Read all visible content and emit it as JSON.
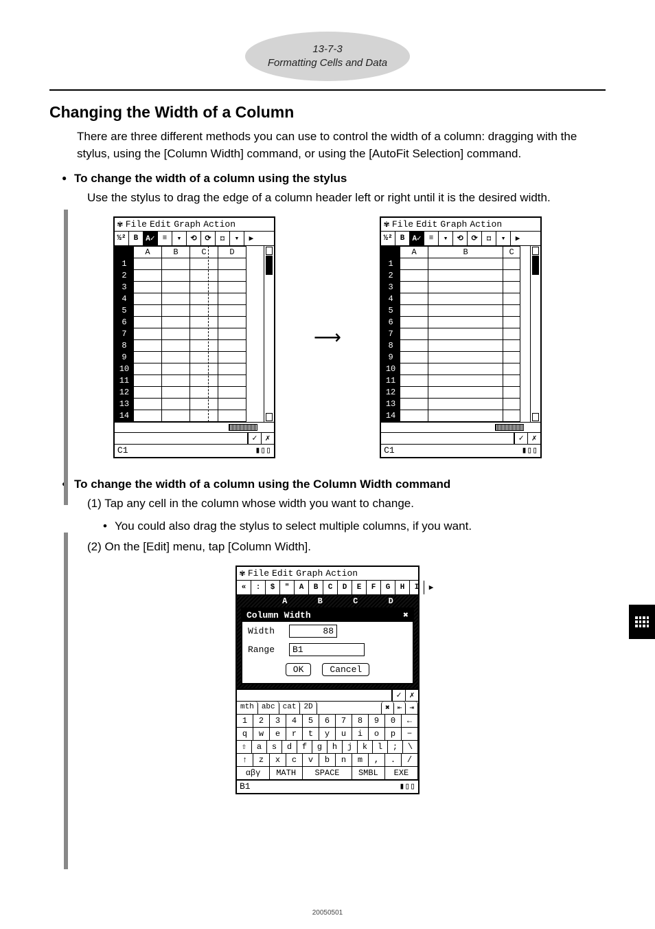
{
  "badge": {
    "line1": "13-7-3",
    "line2": "Formatting Cells and Data"
  },
  "heading": "Changing the Width of a Column",
  "intro": "There are three different methods you can use to control the width of a column: dragging with the stylus, using the [Column Width] command, or using the [AutoFit Selection] command.",
  "section1": {
    "title": "To change the width of a column using the stylus",
    "text": "Use the stylus to drag the edge of a column header left or right until it is the desired width."
  },
  "section2": {
    "title": "To change the width of a column using the Column Width command",
    "step1": "(1) Tap any cell in the column whose width you want to change.",
    "step1_sub": "You could also drag the stylus to select multiple columns, if you want.",
    "step2": "(2) On the [Edit] menu, tap [Column Width]."
  },
  "calc_ui": {
    "menus": [
      "File",
      "Edit",
      "Graph",
      "Action"
    ],
    "toolbar_symbol": "✔",
    "tool_icons": [
      "½²",
      "B",
      "A✓",
      "≡",
      "▾",
      "⟲",
      "⟳",
      "⚃",
      "▾",
      "▶"
    ],
    "columns_narrow": [
      "A",
      "B",
      "C",
      "D"
    ],
    "columns_wide": [
      "A",
      "B",
      "C"
    ],
    "row_count": 14,
    "status_cell": "C1",
    "battery_icon": "▮▯▯",
    "formula_ok": "✓",
    "formula_cancel": "✗"
  },
  "dialog_ui": {
    "menus": [
      "File",
      "Edit",
      "Graph",
      "Action"
    ],
    "tabrow": [
      "«",
      ":",
      "$",
      "\"",
      "A",
      "B",
      "C",
      "D",
      "E",
      "F",
      "G",
      "H",
      "I",
      "▶"
    ],
    "ghost_cols": [
      "A",
      "B",
      "C",
      "D"
    ],
    "title": "Column Width",
    "close_x": "✖",
    "width_label": "Width",
    "width_value": "88",
    "range_label": "Range",
    "range_value": "B1",
    "ok": "OK",
    "cancel": "Cancel",
    "kbd_tabs": [
      "mth",
      "abc",
      "cat",
      "2D"
    ],
    "kbd_side": [
      "✖",
      "⇤",
      "⇥"
    ],
    "num_row": [
      "1",
      "2",
      "3",
      "4",
      "5",
      "6",
      "7",
      "8",
      "9",
      "0",
      "←"
    ],
    "row2": [
      "q",
      "w",
      "e",
      "r",
      "t",
      "y",
      "u",
      "i",
      "o",
      "p",
      "−"
    ],
    "row3": [
      "⇧",
      "a",
      "s",
      "d",
      "f",
      "g",
      "h",
      "j",
      "k",
      "l",
      ";",
      "\\"
    ],
    "row4": [
      "↑",
      "z",
      "x",
      "c",
      "v",
      "b",
      "n",
      "m",
      ",",
      ".",
      "/"
    ],
    "row5_left": "αβγ",
    "row5": [
      "MATH",
      "SPACE",
      "SMBL",
      "EXE"
    ],
    "status_cell": "B1",
    "battery_icon": "▮▯▯"
  },
  "footer": "20050501"
}
